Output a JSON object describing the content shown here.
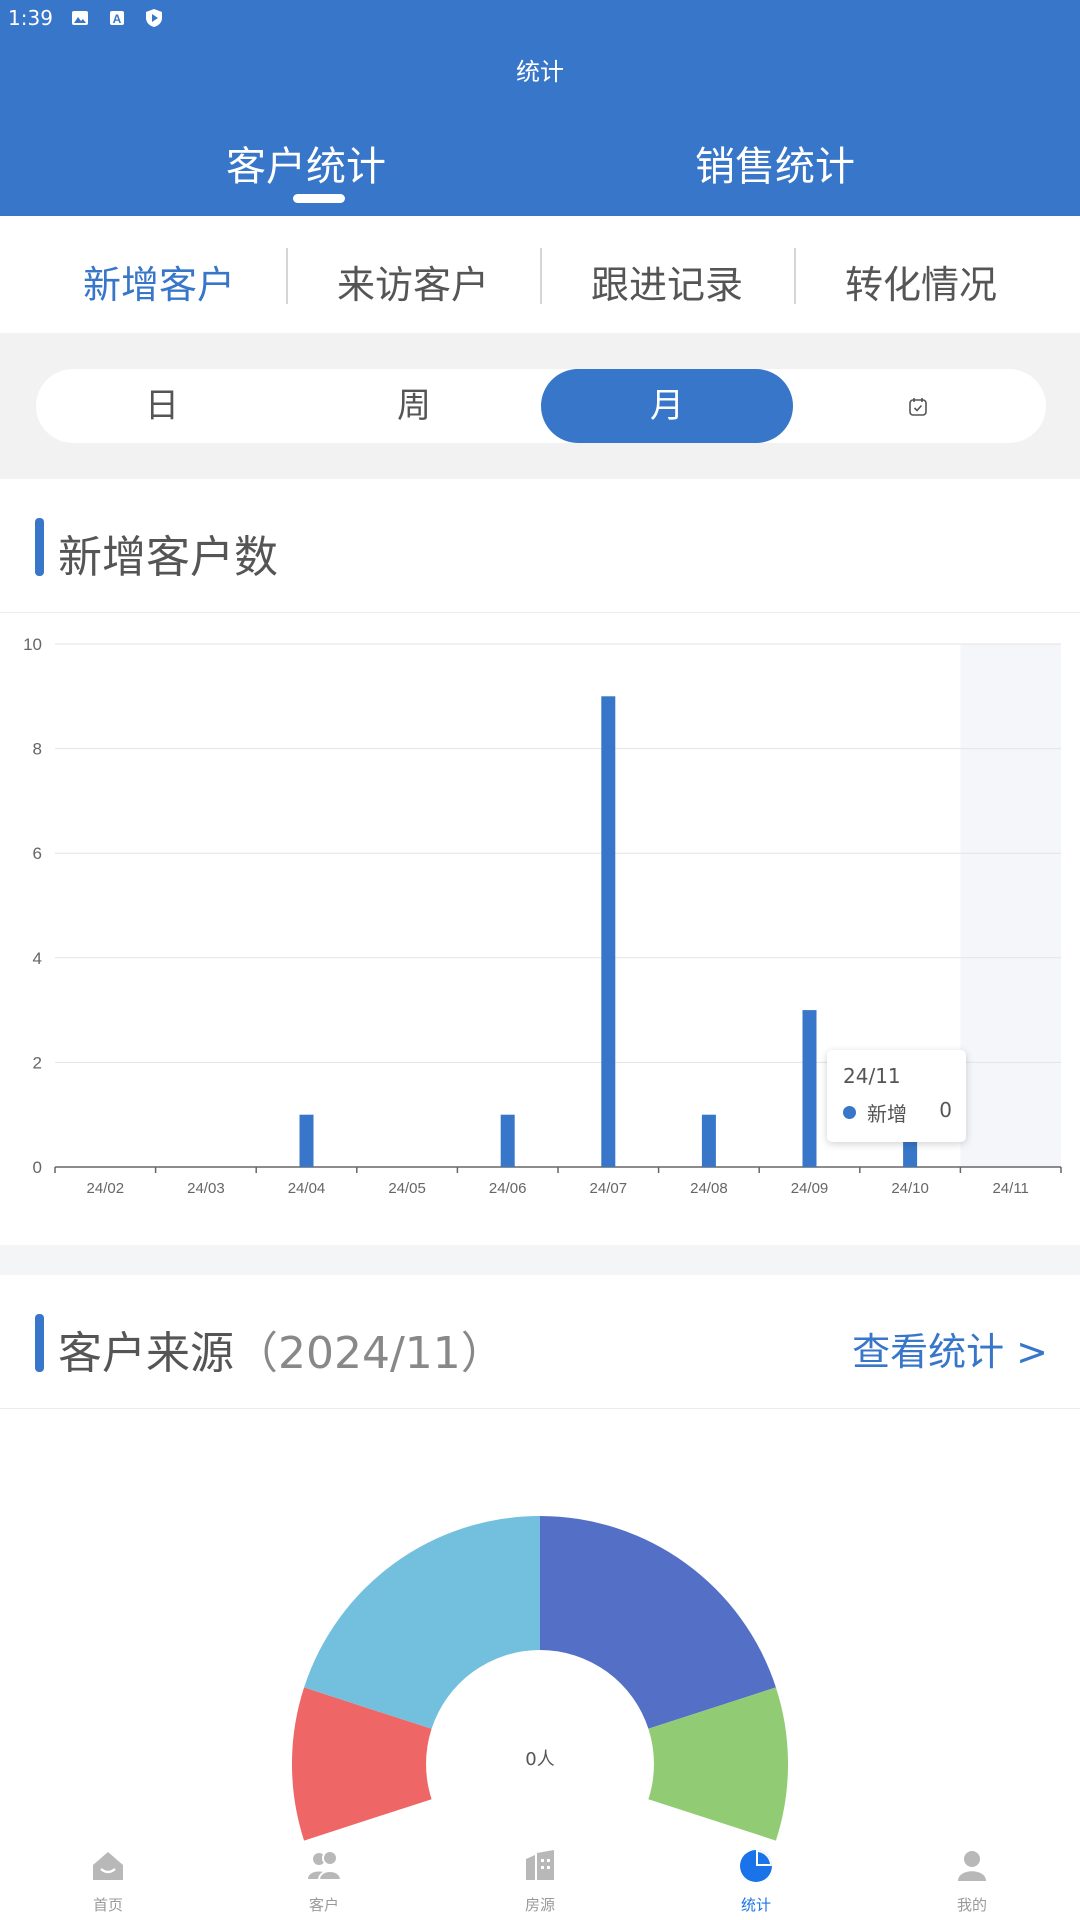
{
  "status_bar": {
    "time": "1:39"
  },
  "header": {
    "title": "统计",
    "tabs": [
      {
        "label": "客户统计",
        "active": true
      },
      {
        "label": "销售统计",
        "active": false
      }
    ]
  },
  "subtabs": [
    {
      "label": "新增客户",
      "active": true
    },
    {
      "label": "来访客户",
      "active": false
    },
    {
      "label": "跟进记录",
      "active": false
    },
    {
      "label": "转化情况",
      "active": false
    }
  ],
  "period": {
    "options": [
      "日",
      "周",
      "月"
    ],
    "selected": "月",
    "calendar_icon": "calendar-check-icon"
  },
  "new_customers": {
    "title": "新增客户数"
  },
  "chart_data": {
    "type": "bar",
    "categories": [
      "24/02",
      "24/03",
      "24/04",
      "24/05",
      "24/06",
      "24/07",
      "24/08",
      "24/09",
      "24/10",
      "24/11"
    ],
    "series": [
      {
        "name": "新增",
        "values": [
          0,
          0,
          1,
          0,
          1,
          9,
          1,
          3,
          1,
          0
        ]
      }
    ],
    "ylim": [
      0,
      10
    ],
    "yticks": [
      "0",
      "2",
      "4",
      "6",
      "8",
      "10"
    ],
    "grid": true,
    "highlighted_category": "24/11",
    "bar_color": "#3776c9"
  },
  "tooltip": {
    "date": "24/11",
    "name": "新增",
    "value": "0"
  },
  "customer_source": {
    "title": "客户来源",
    "period": "（2024/11）",
    "link": "查看统计 >",
    "center_label": "0人",
    "segment_colors": [
      "#5470c6",
      "#91cc75",
      "#ee6666",
      "#73c0de"
    ]
  },
  "bottom_nav": [
    {
      "label": "首页",
      "icon": "home-icon",
      "active": false
    },
    {
      "label": "客户",
      "icon": "customer-icon",
      "active": false
    },
    {
      "label": "房源",
      "icon": "building-icon",
      "active": false
    },
    {
      "label": "统计",
      "icon": "pie-chart-icon",
      "active": true
    },
    {
      "label": "我的",
      "icon": "user-icon",
      "active": false
    }
  ],
  "colors": {
    "primary": "#3776c9",
    "nav_active": "#1a73e8"
  }
}
